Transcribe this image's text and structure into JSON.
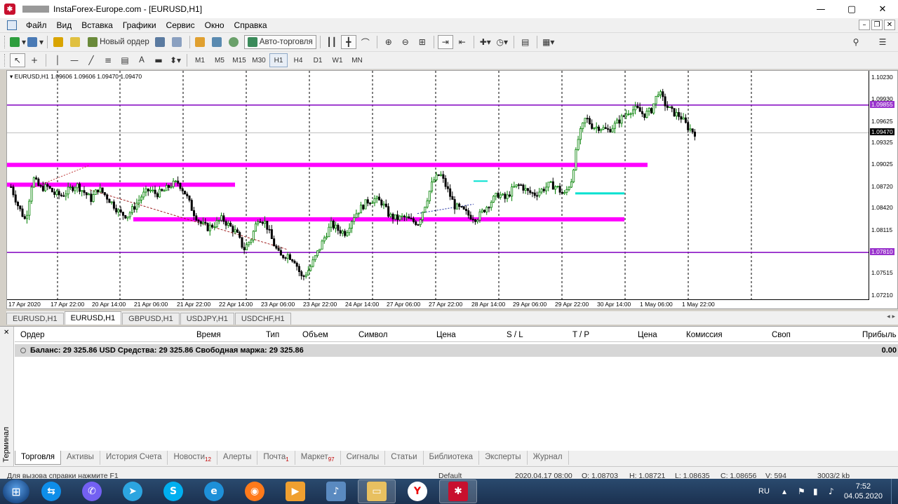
{
  "window": {
    "title": "InstaForex-Europe.com - [EURUSD,H1]",
    "min_glyph": "—",
    "max_glyph": "▢",
    "close_glyph": "✕"
  },
  "menu": {
    "items": [
      "Файл",
      "Вид",
      "Вставка",
      "Графики",
      "Сервис",
      "Окно",
      "Справка"
    ]
  },
  "toolbar": {
    "new_order": "Новый ордер",
    "auto_trading": "Авто-торговля",
    "periods": [
      "M1",
      "M5",
      "M15",
      "M30",
      "H1",
      "H4",
      "D1",
      "W1",
      "MN"
    ],
    "active_period": "H1",
    "text_tool": "A"
  },
  "chart": {
    "header": "EURUSD,H1  1.09606 1.09606 1.09470 1.09470",
    "colors": {
      "bull": "#008000",
      "bear": "#000000",
      "magenta": "#ff00ff",
      "purple": "#8000c0",
      "cyan": "#00e0d0",
      "tag_purple": "#9933cc",
      "tag_black": "#000000"
    },
    "price_labels": [
      "1.10230",
      "1.09930",
      "1.09625",
      "1.09325",
      "1.09025",
      "1.08720",
      "1.08420",
      "1.08115",
      "1.07815",
      "1.07515",
      "1.07210"
    ],
    "price_tags": [
      {
        "text": "1.09855",
        "color": "#9933cc"
      },
      {
        "text": "1.09470",
        "color": "#000000"
      },
      {
        "text": "1.07810",
        "color": "#9933cc"
      }
    ],
    "time_labels": [
      "17 Apr 2020",
      "17 Apr 22:00",
      "20 Apr 14:00",
      "21 Apr 06:00",
      "21 Apr 22:00",
      "22 Apr 14:00",
      "23 Apr 06:00",
      "23 Apr 22:00",
      "24 Apr 14:00",
      "27 Apr 06:00",
      "27 Apr 22:00",
      "28 Apr 14:00",
      "29 Apr 06:00",
      "29 Apr 22:00",
      "30 Apr 14:00",
      "1 May 06:00",
      "1 May 22:00"
    ]
  },
  "chart_data": {
    "type": "candlestick",
    "symbol": "EURUSD",
    "timeframe": "H1",
    "ohlc_last": {
      "open": 1.09606,
      "high": 1.09606,
      "low": 1.0947,
      "close": 1.0947
    },
    "ylim": [
      1.0716,
      1.1028
    ],
    "x": [
      "17 Apr 2020",
      "17 Apr 22:00",
      "20 Apr 14:00",
      "21 Apr 06:00",
      "21 Apr 22:00",
      "22 Apr 14:00",
      "23 Apr 06:00",
      "23 Apr 22:00",
      "24 Apr 14:00",
      "27 Apr 06:00",
      "27 Apr 22:00",
      "28 Apr 14:00",
      "29 Apr 06:00",
      "29 Apr 22:00",
      "30 Apr 14:00",
      "1 May 06:00",
      "1 May 22:00"
    ],
    "close_path": [
      1.0872,
      1.0845,
      1.0825,
      1.0885,
      1.087,
      1.0872,
      1.0862,
      1.086,
      1.0868,
      1.0875,
      1.0865,
      1.0855,
      1.087,
      1.086,
      1.0848,
      1.0835,
      1.0832,
      1.0845,
      1.086,
      1.0868,
      1.0862,
      1.0866,
      1.0875,
      1.0878,
      1.0862,
      1.0838,
      1.0822,
      1.0815,
      1.082,
      1.0828,
      1.0818,
      1.0808,
      1.0785,
      1.08,
      1.083,
      1.0822,
      1.0795,
      1.0775,
      1.0778,
      1.077,
      1.0745,
      1.0758,
      1.0778,
      1.08,
      1.082,
      1.0812,
      1.0808,
      1.083,
      1.0842,
      1.0852,
      1.0855,
      1.085,
      1.0832,
      1.0828,
      1.083,
      1.0825,
      1.0822,
      1.085,
      1.088,
      1.089,
      1.0868,
      1.0845,
      1.084,
      1.0832,
      1.0828,
      1.084,
      1.0852,
      1.0862,
      1.0855,
      1.087,
      1.0875,
      1.0865,
      1.0862,
      1.0868,
      1.0875,
      1.0872,
      1.086,
      1.088,
      1.094,
      1.0968,
      1.0955,
      1.0955,
      1.095,
      1.0958,
      1.0968,
      1.0978,
      1.098,
      1.0972,
      1.0978,
      1.1005,
      1.0985,
      1.0975,
      1.097,
      1.0955,
      1.0947
    ],
    "levels": [
      {
        "price": 1.09855,
        "style": "thin-purple"
      },
      {
        "price": 1.0781,
        "style": "thin-purple"
      },
      {
        "price": 1.09025,
        "style": "thick-magenta"
      },
      {
        "price": 1.0875,
        "style": "thick-magenta"
      },
      {
        "price": 1.0827,
        "style": "thick-magenta"
      }
    ],
    "grid": "vertical-dashed"
  },
  "chart_tabs": [
    "EURUSD,H1",
    "EURUSD,H1",
    "GBPUSD,H1",
    "USDJPY,H1",
    "USDCHF,H1"
  ],
  "active_chart_tab": 1,
  "terminal": {
    "side_label": "Терминал",
    "columns": [
      "Ордер",
      "Время",
      "Тип",
      "Объем",
      "Символ",
      "Цена",
      "S / L",
      "T / P",
      "Цена",
      "Комиссия",
      "Своп",
      "Прибыль"
    ],
    "balance_text": "Баланс: 29 325.86 USD  Средства: 29 325.86  Свободная маржа: 29 325.86",
    "profit": "0.00",
    "tabs": [
      {
        "label": "Торговля",
        "badge": ""
      },
      {
        "label": "Активы",
        "badge": ""
      },
      {
        "label": "История Счета",
        "badge": ""
      },
      {
        "label": "Новости",
        "badge": "12"
      },
      {
        "label": "Алерты",
        "badge": ""
      },
      {
        "label": "Почта",
        "badge": "1"
      },
      {
        "label": "Маркет",
        "badge": "97"
      },
      {
        "label": "Сигналы",
        "badge": ""
      },
      {
        "label": "Статьи",
        "badge": ""
      },
      {
        "label": "Библиотека",
        "badge": ""
      },
      {
        "label": "Эксперты",
        "badge": ""
      },
      {
        "label": "Журнал",
        "badge": ""
      }
    ]
  },
  "status": {
    "help": "Для вызова справки нажмите F1",
    "profile": "Default",
    "datetime": "2020.04.17 08:00",
    "open": "O: 1.08703",
    "high": "H: 1.08721",
    "low": "L: 1.08635",
    "close": "C: 1.08656",
    "volume": "V: 594",
    "traffic": "3003/2 kb"
  },
  "taskbar": {
    "lang": "RU",
    "time": "7:52",
    "date": "04.05.2020"
  }
}
